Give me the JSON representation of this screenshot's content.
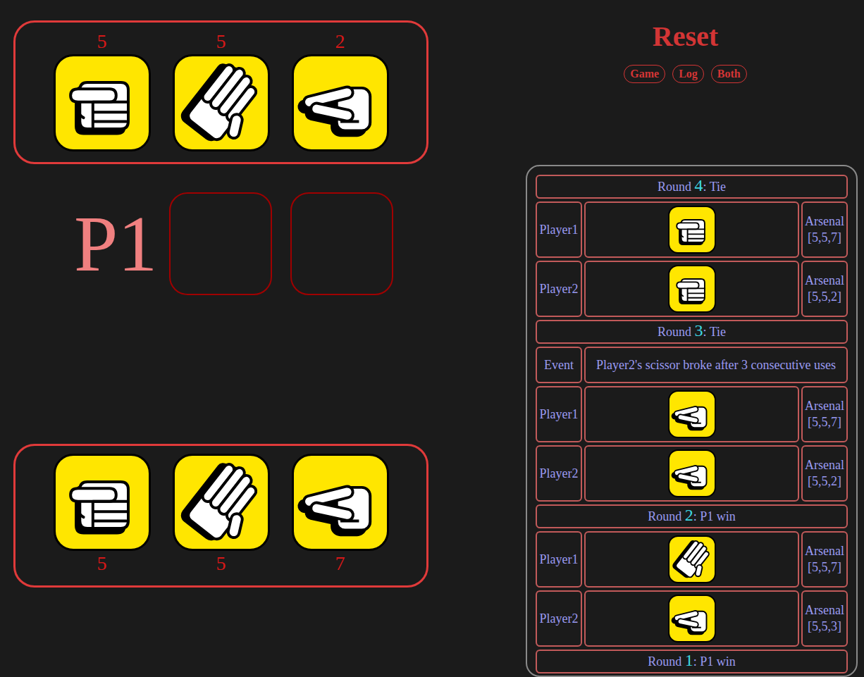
{
  "opponent": {
    "hand": [
      {
        "kind": "rock",
        "count": "5"
      },
      {
        "kind": "paper",
        "count": "5"
      },
      {
        "kind": "scissors",
        "count": "2"
      }
    ]
  },
  "turn": {
    "label": "P1",
    "slots": [
      {
        "filled": false
      },
      {
        "filled": false
      }
    ]
  },
  "player": {
    "hand": [
      {
        "kind": "rock",
        "count": "5"
      },
      {
        "kind": "paper",
        "count": "5"
      },
      {
        "kind": "scissors",
        "count": "7"
      }
    ]
  },
  "controls": {
    "title": "Reset",
    "buttons": [
      {
        "label": "Game"
      },
      {
        "label": "Log"
      },
      {
        "label": "Both"
      }
    ]
  },
  "log": {
    "rounds": [
      {
        "prefix": "Round ",
        "number": "4",
        "result": ": Tie",
        "entries": [
          {
            "kind": "move",
            "label": "Player1",
            "move": "rock",
            "arsenal_label": "Arsenal",
            "arsenal": "[5,5,7]"
          },
          {
            "kind": "move",
            "label": "Player2",
            "move": "rock",
            "arsenal_label": "Arsenal",
            "arsenal": "[5,5,2]"
          }
        ]
      },
      {
        "prefix": "Round ",
        "number": "3",
        "result": ": Tie",
        "entries": [
          {
            "kind": "event",
            "label": "Event",
            "text": "Player2's scissor broke after 3 consecutive uses"
          },
          {
            "kind": "move",
            "label": "Player1",
            "move": "scissors",
            "arsenal_label": "Arsenal",
            "arsenal": "[5,5,7]"
          },
          {
            "kind": "move",
            "label": "Player2",
            "move": "scissors",
            "arsenal_label": "Arsenal",
            "arsenal": "[5,5,2]"
          }
        ]
      },
      {
        "prefix": "Round ",
        "number": "2",
        "result": ": P1 win",
        "entries": [
          {
            "kind": "move",
            "label": "Player1",
            "move": "paper",
            "arsenal_label": "Arsenal",
            "arsenal": "[5,5,7]"
          },
          {
            "kind": "move",
            "label": "Player2",
            "move": "scissors",
            "arsenal_label": "Arsenal",
            "arsenal": "[5,5,3]"
          }
        ]
      },
      {
        "prefix": "Round ",
        "number": "1",
        "result": ": P1 win",
        "entries": []
      }
    ]
  }
}
